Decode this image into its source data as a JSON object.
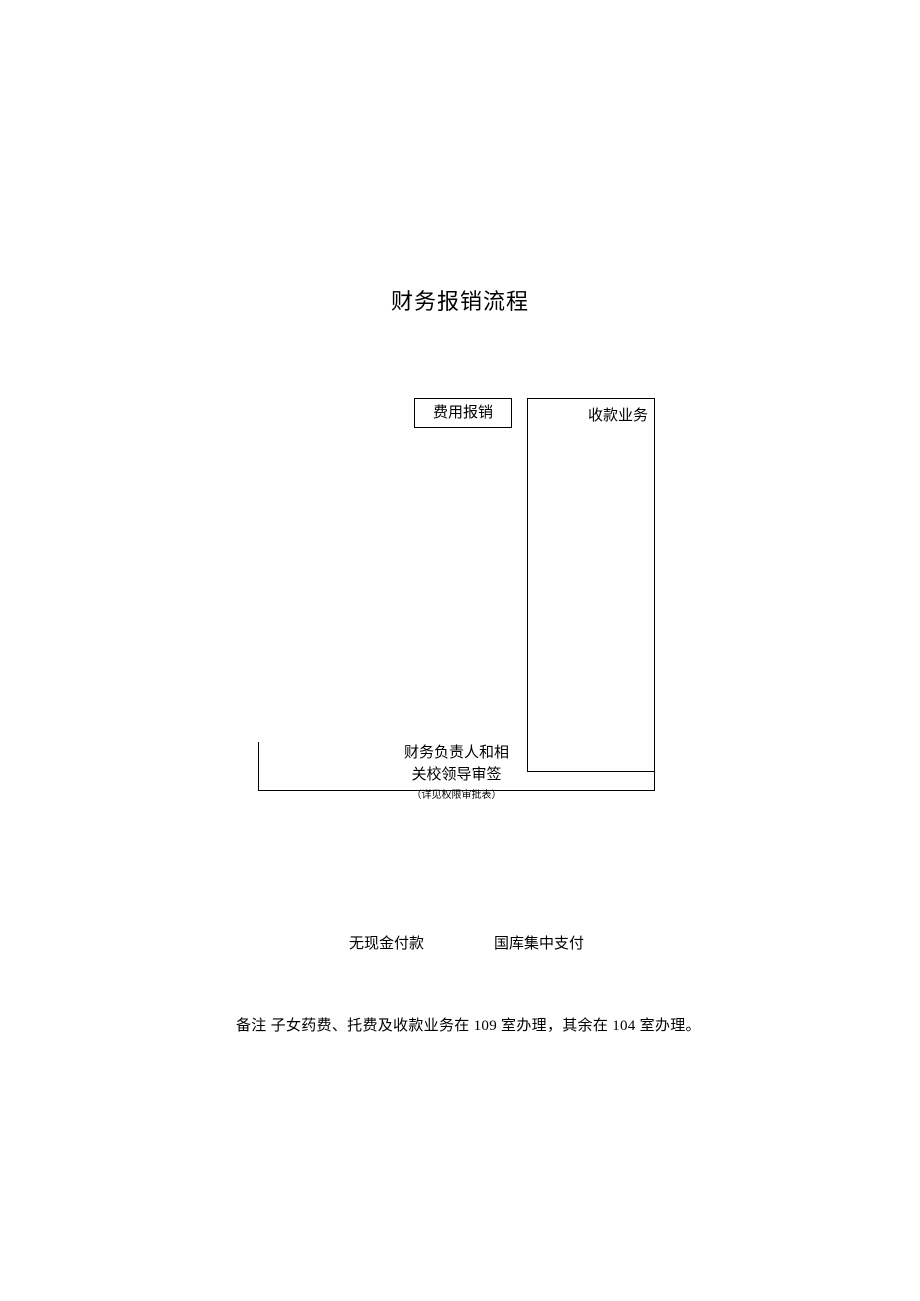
{
  "title": "财务报销流程",
  "flow": {
    "expense_box": "费用报销",
    "receipt_box": "收款业务",
    "approval": {
      "line1": "财务负责人和相",
      "line2": "关校领导审签",
      "note": "（详见权限审批表）"
    },
    "payment": {
      "no_cash": "无现金付款",
      "treasury": "国库集中支付"
    }
  },
  "footnote": "备注 子女药费、托费及收款业务在 109 室办理，其余在 104 室办理。"
}
